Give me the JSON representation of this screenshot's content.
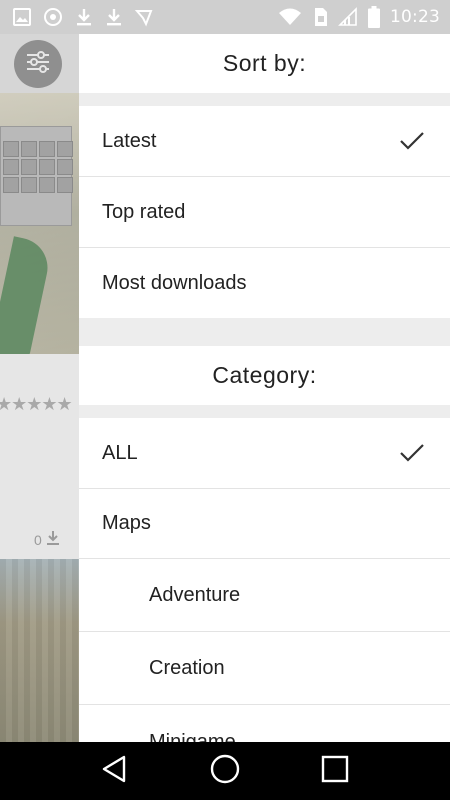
{
  "status_bar": {
    "time": "10:23",
    "left_icons": [
      "image-icon",
      "cast-icon",
      "download-icon",
      "download-icon",
      "messenger-icon"
    ],
    "right_icons": [
      "wifi-icon",
      "sim-card-icon",
      "signal-icon",
      "battery-icon"
    ]
  },
  "background_app": {
    "download_count": "0",
    "rating_stars": 5
  },
  "drawer": {
    "sort_title": "Sort by:",
    "sort_options": [
      {
        "label": "Latest",
        "selected": true
      },
      {
        "label": "Top rated",
        "selected": false
      },
      {
        "label": "Most downloads",
        "selected": false
      }
    ],
    "category_title": "Category:",
    "categories": [
      {
        "label": "ALL",
        "selected": true,
        "sub": false
      },
      {
        "label": "Maps",
        "selected": false,
        "sub": false
      },
      {
        "label": "Adventure",
        "selected": false,
        "sub": true
      },
      {
        "label": "Creation",
        "selected": false,
        "sub": true
      },
      {
        "label": "Minigame",
        "selected": false,
        "sub": true
      }
    ]
  },
  "nav_bar": {
    "buttons": [
      "back-icon",
      "home-icon",
      "recents-icon"
    ]
  },
  "colors": {
    "check": "#333333",
    "divider": "#e3e3e3",
    "section_gap": "#ededed"
  }
}
